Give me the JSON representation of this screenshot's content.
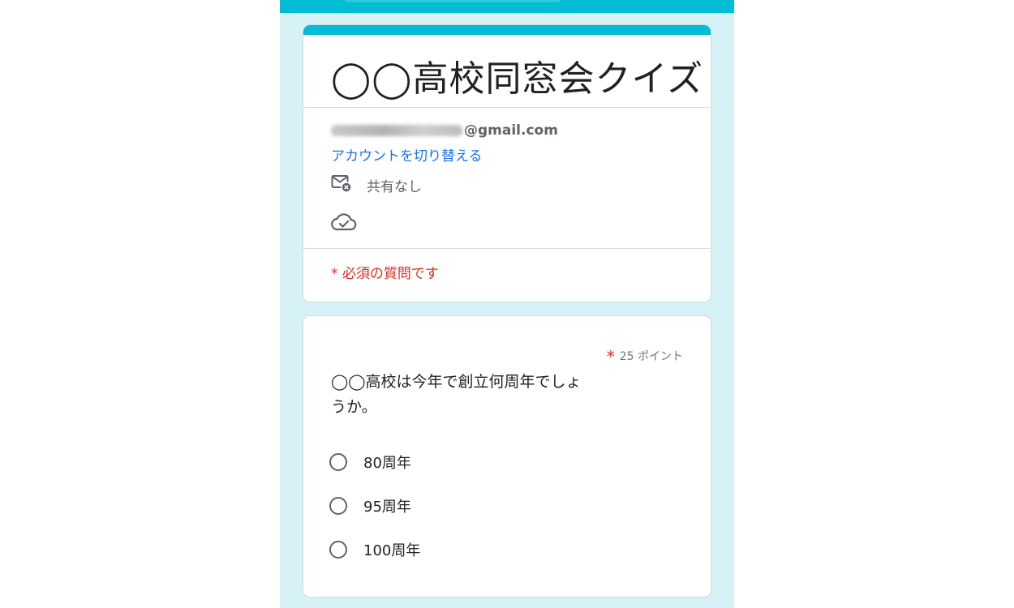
{
  "form": {
    "title": "◯◯高校同窓会クイズ",
    "email_suffix": "@gmail.com",
    "switch_account": "アカウントを切り替える",
    "share_status": "共有なし",
    "required_note": "* 必須の質問です"
  },
  "question": {
    "required_star": "*",
    "points": "25 ポイント",
    "text": "◯◯高校は今年で創立何周年でしょうか。",
    "options": [
      {
        "label": "80周年"
      },
      {
        "label": "95周年"
      },
      {
        "label": "100周年"
      }
    ]
  },
  "colors": {
    "accent": "#00bcd4",
    "background": "#d7f2f6",
    "link": "#1a73e8",
    "required": "#d93025"
  },
  "icons": [
    "mail-off-icon",
    "cloud-check-icon",
    "radio-unchecked-icon"
  ]
}
